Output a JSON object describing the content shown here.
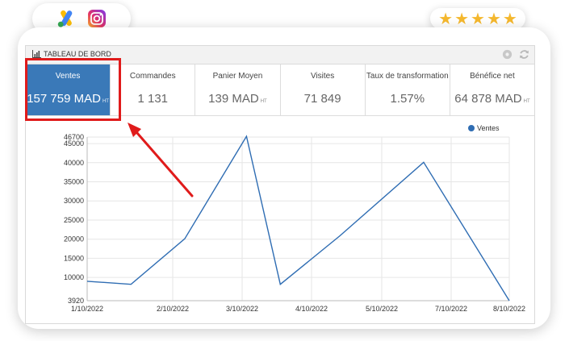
{
  "header": {
    "apps": [
      {
        "name": "google-ads",
        "icon": "google-ads-icon"
      },
      {
        "name": "instagram",
        "icon": "instagram-icon"
      }
    ],
    "rating": {
      "stars": 5,
      "max": 5
    }
  },
  "panel": {
    "title": "TABLEAU DE BORD",
    "tools": [
      "gear-icon",
      "refresh-icon"
    ]
  },
  "kpis": [
    {
      "label": "Ventes",
      "value": "157 759 MAD",
      "suffix": "HT",
      "active": true
    },
    {
      "label": "Commandes",
      "value": "1 131",
      "suffix": ""
    },
    {
      "label": "Panier Moyen",
      "value": "139 MAD",
      "suffix": "HT"
    },
    {
      "label": "Visites",
      "value": "71 849",
      "suffix": ""
    },
    {
      "label": "Taux de transformation",
      "value": "1.57%",
      "suffix": ""
    },
    {
      "label": "Bénéfice net",
      "value": "64 878 MAD",
      "suffix": "HT"
    }
  ],
  "annotation": {
    "color": "#e01b1b"
  },
  "colors": {
    "accent": "#3a79b8",
    "line": "#2f6db3",
    "highlight": "#e01b1b"
  },
  "chart_data": {
    "type": "line",
    "legend": "top-right",
    "grid": true,
    "series": [
      {
        "name": "Ventes",
        "color": "#2f6db3",
        "points": [
          {
            "x": "1/10/2022",
            "y": 9000
          },
          {
            "x": "2/1/2022",
            "y": 8200
          },
          {
            "x": "2/28/2022",
            "y": 20100
          },
          {
            "x": "3/31/2022",
            "y": 46900
          },
          {
            "x": "4/17/2022",
            "y": 8200
          },
          {
            "x": "5/17/2022",
            "y": 20900
          },
          {
            "x": "6/28/2022",
            "y": 40100
          },
          {
            "x": "8/10/2022",
            "y": 3920
          }
        ]
      }
    ],
    "x_ticks": [
      "1/10/2022",
      "2/10/2022",
      "3/10/2022",
      "4/10/2022",
      "5/10/2022",
      "7/10/2022",
      "8/10/2022"
    ],
    "y_ticks": [
      3920,
      10000,
      15000,
      20000,
      25000,
      30000,
      35000,
      40000,
      45000,
      46700
    ],
    "ylim": [
      3920,
      46700
    ]
  }
}
